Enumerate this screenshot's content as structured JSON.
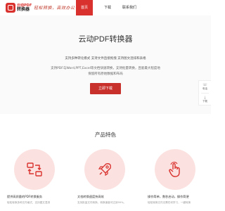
{
  "header": {
    "logo_en": "云动PDF",
    "logo_cn": "转换器",
    "slogan": "轻松转换，高效办公",
    "nav": [
      {
        "label": "首页",
        "active": true
      },
      {
        "label": "下载",
        "active": false
      },
      {
        "label": "联系我们",
        "active": false
      }
    ]
  },
  "hero": {
    "title": "云动PDF转换器",
    "subtitle": "支持多种转化模式 支持文件直接拖拽 支持图文混排和表格",
    "desc_line1": "支持PDF与Word,PPT,Excel等文档快速转换，支持批量转换，且能最大程度地",
    "desc_line2": "保留所有原始数据和布局",
    "download_button": "立即下载"
  },
  "side_float": {
    "items": [
      {
        "icon": "phone-icon",
        "glyph": "☏",
        "label": "电话"
      },
      {
        "icon": "download-icon",
        "glyph": "⤓",
        "label": "下载"
      }
    ]
  },
  "features": {
    "title": "产品特色",
    "items": [
      {
        "icon": "convert-arrows-icon",
        "title": "提供高质量的PDF转换服务",
        "desc": "轻松转换多种文件格式，支持图文混排"
      },
      {
        "icon": "rocket-icon",
        "title": "文档转换速度快高效",
        "desc": "支持批量文件转换，转换速度可达到99%。"
      },
      {
        "icon": "hand-touch-icon",
        "title": "操作简单，数秒启动，操作简便",
        "desc": "轻松转换文件无需任何学习，一键转换"
      }
    ]
  },
  "colors": {
    "brand_red": "#d9322e",
    "button_red": "#c8302b",
    "feature_circle": "#fbe2e0"
  }
}
